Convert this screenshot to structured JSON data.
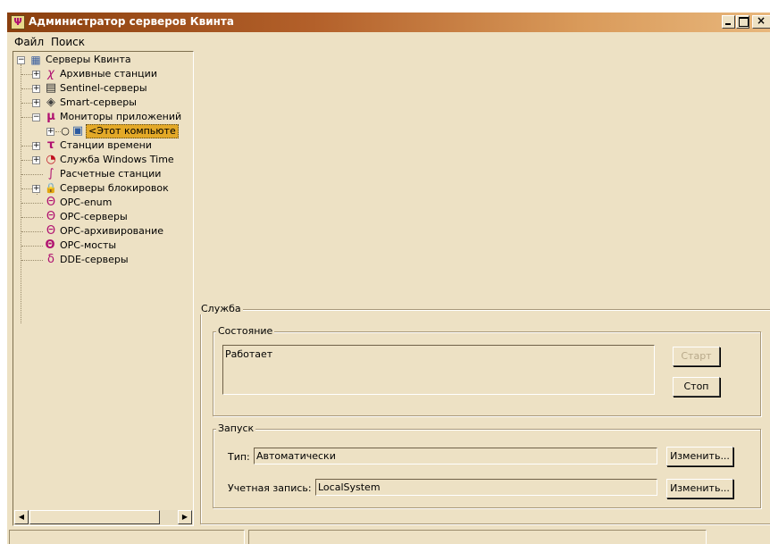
{
  "window": {
    "title": "Администратор серверов Квинта"
  },
  "menu": {
    "items": [
      "Файл",
      "Поиск"
    ]
  },
  "tree": {
    "root": "Серверы Квинта",
    "items": [
      {
        "icon": "chi-icon",
        "glyph": "χ",
        "label": "Архивные станции"
      },
      {
        "icon": "server-icon",
        "glyph": "▤",
        "label": "Sentinel-серверы"
      },
      {
        "icon": "disk-icon",
        "glyph": "◈",
        "label": "Smart-серверы"
      },
      {
        "icon": "mu-icon",
        "glyph": "μ",
        "label": "Мониторы приложений"
      },
      {
        "icon": "computer-icon",
        "glyph": "▣",
        "label": "<Этот компьюте"
      },
      {
        "icon": "tau-icon",
        "glyph": "τ",
        "label": "Станции времени"
      },
      {
        "icon": "clock-icon",
        "glyph": "◔",
        "label": "Служба Windows Time"
      },
      {
        "icon": "integral-icon",
        "glyph": "∫",
        "label": "Расчетные станции"
      },
      {
        "icon": "lock-icon",
        "glyph": "🔒",
        "label": "Серверы блокировок"
      },
      {
        "icon": "theta-icon",
        "glyph": "Θ",
        "label": "OPC-enum"
      },
      {
        "icon": "theta-icon",
        "glyph": "Θ",
        "label": "OPC-серверы"
      },
      {
        "icon": "theta-icon",
        "glyph": "Θ",
        "label": "OPC-архивирование"
      },
      {
        "icon": "theta-bridge-icon",
        "glyph": "Θ",
        "label": "OPC-мосты"
      },
      {
        "icon": "delta-icon",
        "glyph": "δ",
        "label": "DDE-серверы"
      }
    ]
  },
  "service": {
    "group_label": "Служба",
    "state": {
      "group_label": "Состояние",
      "value": "Работает",
      "start_label": "Старт",
      "stop_label": "Стоп"
    },
    "launch": {
      "group_label": "Запуск",
      "type_label": "Тип:",
      "type_value": "Автоматически",
      "account_label": "Учетная запись:",
      "account_value": "LocalSystem",
      "change_label": "Изменить..."
    }
  },
  "colors": {
    "background": "#ede1c4",
    "title_start": "#8a3f0e",
    "title_end": "#e8b77c",
    "selection": "#e3a928",
    "accent": "#b01070"
  }
}
